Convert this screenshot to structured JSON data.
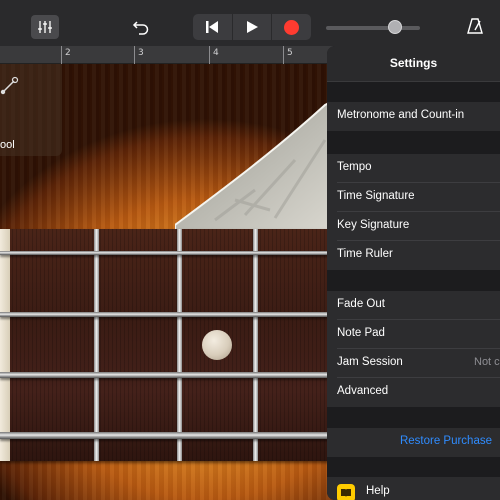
{
  "toolbar": {
    "mixer_icon": "sliders-icon",
    "undo_icon": "undo-icon",
    "rewind_icon": "skip-back-icon",
    "play_icon": "play-icon",
    "record_icon": "record-icon",
    "record_color": "#ff3b30",
    "metronome_icon": "metronome-icon"
  },
  "ruler": {
    "marks": [
      "2",
      "3",
      "4",
      "5"
    ]
  },
  "instrument": {
    "tool_label": "ool",
    "tool_icon": "guitar-icon"
  },
  "settings": {
    "title": "Settings",
    "metronome": "Metronome and Count-in",
    "tempo": "Tempo",
    "time_signature": "Time Signature",
    "key_signature": "Key Signature",
    "time_ruler": "Time Ruler",
    "fade_out": "Fade Out",
    "note_pad": "Note Pad",
    "jam_session": "Jam Session",
    "jam_session_value": "Not c",
    "advanced": "Advanced",
    "restore_purchase": "Restore Purchase",
    "help": "Help",
    "help_icon": "help-book-icon",
    "accent_color": "#2f8cff"
  }
}
